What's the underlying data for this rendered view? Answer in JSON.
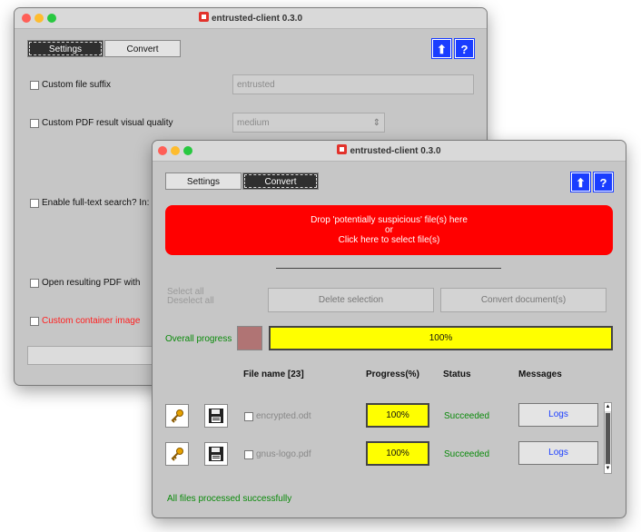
{
  "back_window": {
    "title": "entrusted-client 0.3.0",
    "tabs": [
      {
        "label": "Settings",
        "active": true
      },
      {
        "label": "Convert",
        "active": false
      }
    ],
    "options": {
      "custom_suffix": {
        "label": "Custom file suffix",
        "value": "entrusted"
      },
      "visual_quality": {
        "label": "Custom PDF result visual quality",
        "value": "medium"
      },
      "fulltext": {
        "label": "Enable full-text search? In:"
      },
      "open_with": {
        "label": "Open resulting PDF with"
      },
      "container_image": {
        "label": "Custom container image"
      }
    },
    "icons": [
      "upload-icon",
      "help-icon"
    ]
  },
  "front_window": {
    "title": "entrusted-client 0.3.0",
    "tabs": [
      {
        "label": "Settings",
        "active": false
      },
      {
        "label": "Convert",
        "active": true
      }
    ],
    "drop_zone": {
      "line1": "Drop 'potentially suspicious' file(s) here",
      "line2": "or",
      "line3": "Click here to select file(s)"
    },
    "select_all": "Select all",
    "deselect_all": "Deselect all",
    "delete_selection": "Delete selection",
    "convert_documents": "Convert document(s)",
    "overall_progress_label": "Overall progress",
    "overall_progress_value": "100%",
    "overall_progress_fraction": 1.0,
    "table": {
      "headers": {
        "filename": "File name [23]",
        "progress": "Progress(%)",
        "status": "Status",
        "messages": "Messages"
      },
      "rows": [
        {
          "filename": "encrypted.odt",
          "progress": "100%",
          "status": "Succeeded",
          "logs": "Logs"
        },
        {
          "filename": "gnus-logo.pdf",
          "progress": "100%",
          "status": "Succeeded",
          "logs": "Logs"
        }
      ]
    },
    "footer_status": "All files processed successfully",
    "colors": {
      "drop_zone": "#ff0000",
      "progress_fill": "#ffff00",
      "status_ok": "#0a8a0a",
      "accent": "#1a3dff"
    }
  }
}
